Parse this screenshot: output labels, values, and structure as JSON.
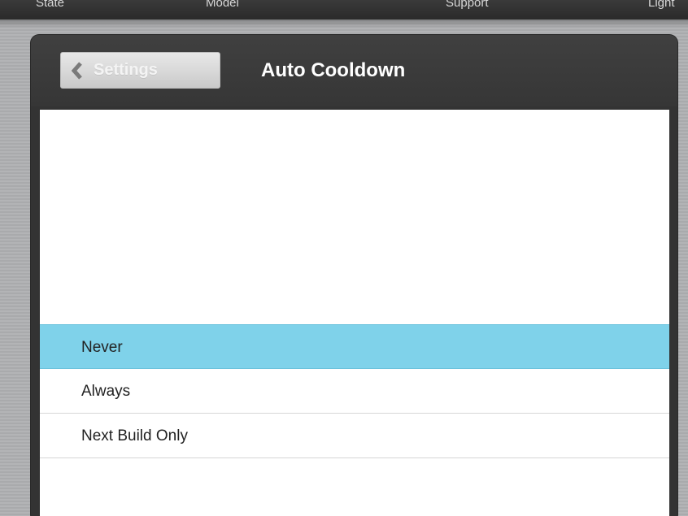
{
  "top_tabs": [
    "State",
    "Model",
    "Support",
    "Light"
  ],
  "nav": {
    "back_label": "Settings",
    "title": "Auto Cooldown"
  },
  "options": {
    "items": [
      "Never",
      "Always",
      "Next Build Only"
    ],
    "selected": "Never",
    "selected_color": "#7fd2ea"
  },
  "icons": {
    "back": "chevron-left-icon"
  }
}
